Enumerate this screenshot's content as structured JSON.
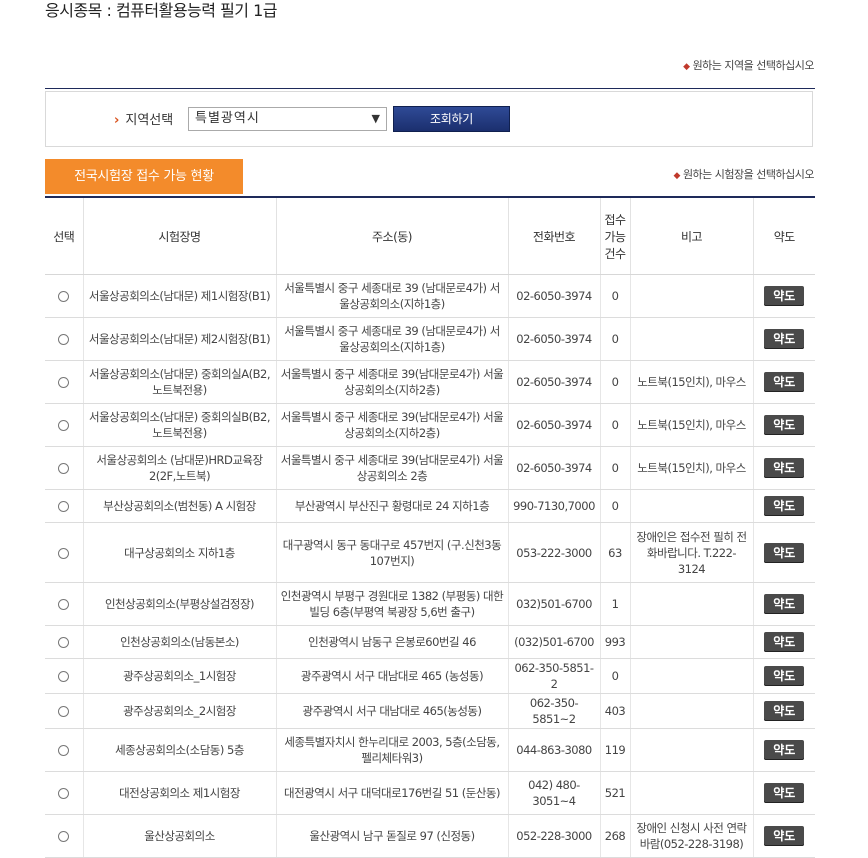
{
  "exam": {
    "title": "응시종목 : 컴퓨터활용능력 필기 1급"
  },
  "hints": {
    "region": "원하는 지역을 선택하십시오",
    "site": "원하는 시험장을 선택하십시오"
  },
  "search": {
    "label": "지역선택",
    "selected_region": "특별광역시",
    "query_button": "조회하기"
  },
  "status_tab": {
    "label": "전국시험장 접수 가능 현황"
  },
  "table": {
    "headers": {
      "select": "선택",
      "name": "시험장명",
      "address": "주소(동)",
      "phone": "전화번호",
      "count": "접수가능건수",
      "note": "비고",
      "map": "약도"
    },
    "map_button_label": "약도",
    "rows": [
      {
        "name": "서울상공회의소(남대문) 제1시험장(B1)",
        "address": "서울특별시 중구 세종대로 39 (남대문로4가) 서울상공회의소(지하1층)",
        "phone": "02-6050-3974",
        "count": "0",
        "note": ""
      },
      {
        "name": "서울상공회의소(남대문) 제2시험장(B1)",
        "address": "서울특별시 중구 세종대로 39 (남대문로4가) 서울상공회의소(지하1층)",
        "phone": "02-6050-3974",
        "count": "0",
        "note": ""
      },
      {
        "name": "서울상공회의소(남대문) 중회의실A(B2,노트북전용)",
        "address": "서울특별시 중구 세종대로 39(남대문로4가) 서울상공회의소(지하2층)",
        "phone": "02-6050-3974",
        "count": "0",
        "note": "노트북(15인치), 마우스"
      },
      {
        "name": "서울상공회의소(남대문) 중회의실B(B2,노트북전용)",
        "address": "서울특별시 중구 세종대로 39(남대문로4가) 서울상공회의소(지하2층)",
        "phone": "02-6050-3974",
        "count": "0",
        "note": "노트북(15인치), 마우스"
      },
      {
        "name": "서울상공회의소 (남대문)HRD교육장2(2F,노트북)",
        "address": "서울특별시 중구 세종대로 39(남대문로4가) 서울상공회의소 2층",
        "phone": "02-6050-3974",
        "count": "0",
        "note": "노트북(15인치), 마우스"
      },
      {
        "name": "부산상공회의소(범천동) A 시험장",
        "address": "부산광역시 부산진구 황령대로 24 지하1층",
        "phone": "990-7130,7000",
        "count": "0",
        "note": ""
      },
      {
        "name": "대구상공회의소 지하1층",
        "address": "대구광역시 동구 동대구로 457번지 (구.신천3동 107번지)",
        "phone": "053-222-3000",
        "count": "63",
        "note": "장애인은 접수전 필히 전화바랍니다. T.222-3124"
      },
      {
        "name": "인천상공회의소(부평상설검정장)",
        "address": "인천광역시 부평구 경원대로 1382 (부평동) 대한빌딩 6층(부평역 북광장 5,6번 출구)",
        "phone": "032)501-6700",
        "count": "1",
        "note": ""
      },
      {
        "name": "인천상공회의소(남동본소)",
        "address": "인천광역시 남동구 은봉로60번길 46",
        "phone": "(032)501-6700",
        "count": "993",
        "note": ""
      },
      {
        "name": "광주상공회의소_1시험장",
        "address": "광주광역시 서구 대남대로 465 (농성동)",
        "phone": "062-350-5851-2",
        "count": "0",
        "note": ""
      },
      {
        "name": "광주상공회의소_2시험장",
        "address": "광주광역시 서구 대남대로 465(농성동)",
        "phone": "062-350-5851~2",
        "count": "403",
        "note": ""
      },
      {
        "name": "세종상공회의소(소담동) 5층",
        "address": "세종특별자치시 한누리대로 2003, 5층(소담동, 펠리체타워3)",
        "phone": "044-863-3080",
        "count": "119",
        "note": ""
      },
      {
        "name": "대전상공회의소 제1시험장",
        "address": "대전광역시 서구 대덕대로176번길 51 (둔산동)",
        "phone": "042) 480-3051~4",
        "count": "521",
        "note": ""
      },
      {
        "name": "울산상공회의소",
        "address": "울산광역시 남구 돋질로 97 (신정동)",
        "phone": "052-228-3000",
        "count": "268",
        "note": "장애인 신청시 사전 연락 바람(052-228-3198)"
      }
    ]
  }
}
